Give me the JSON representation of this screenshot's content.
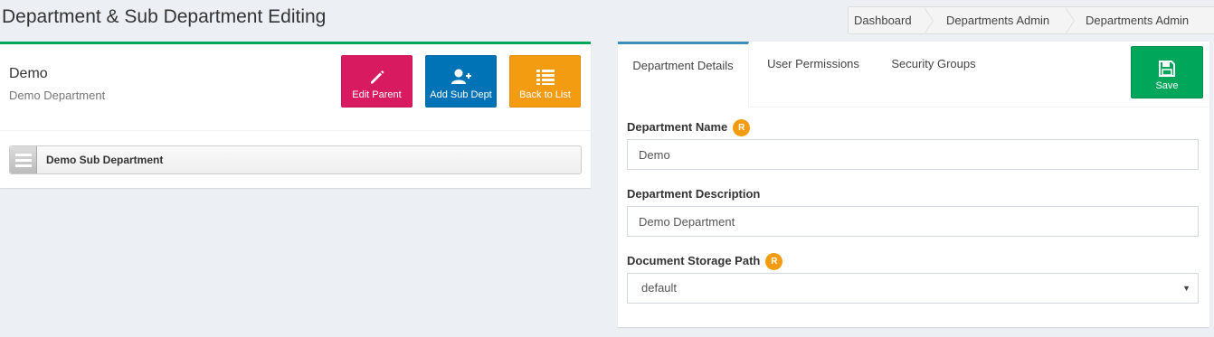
{
  "page": {
    "title": "Department & Sub Department Editing"
  },
  "breadcrumb": {
    "items": [
      "Dashboard",
      "Departments Admin",
      "Departments Admin"
    ]
  },
  "department": {
    "name": "Demo",
    "description": "Demo Department"
  },
  "actions": {
    "edit_parent": "Edit Parent",
    "add_sub_dept": "Add Sub Dept",
    "back_to_list": "Back to List"
  },
  "sub_departments": [
    {
      "label": "Demo Sub Department"
    }
  ],
  "tabs": [
    {
      "label": "Department Details",
      "active": true
    },
    {
      "label": "User Permissions",
      "active": false
    },
    {
      "label": "Security Groups",
      "active": false
    }
  ],
  "save_label": "Save",
  "form": {
    "name_label": "Department Name",
    "name_value": "Demo",
    "description_label": "Department Description",
    "description_value": "Demo Department",
    "storage_label": "Document Storage Path",
    "storage_value": "default",
    "required_badge": "R"
  },
  "colors": {
    "edit_parent": "#d81b60",
    "add_sub_dept": "#0073b7",
    "back_to_list": "#f39c12",
    "save": "#00a65a",
    "box_top": "#00a65a",
    "tab_active": "#3c8dbc",
    "required": "#f39c12"
  },
  "icons": {
    "edit_parent": "pencil-icon",
    "add_sub_dept": "user-plus-icon",
    "back_to_list": "list-icon",
    "save": "floppy-disk-icon",
    "sub_item_handle": "drag-handle-icon",
    "select": "caret-down-icon"
  }
}
